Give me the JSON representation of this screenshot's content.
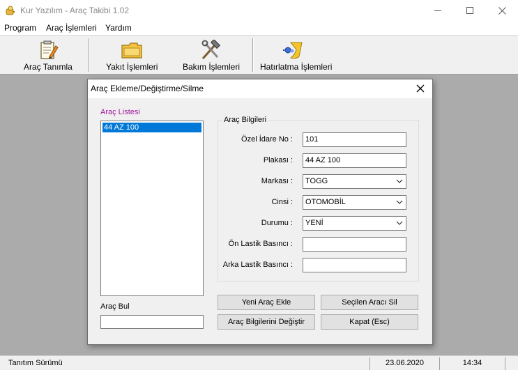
{
  "window": {
    "title": "Kur Yazılım - Araç Takibi 1.02",
    "icons": [
      "app-icon",
      "minimize-icon",
      "maximize-icon",
      "close-icon"
    ]
  },
  "menu": {
    "items": [
      "Program",
      "Araç İşlemleri",
      "Yardım"
    ]
  },
  "toolbar": {
    "buttons": [
      {
        "label": "Araç Tanımla",
        "icon": "clipboard-pencil-icon"
      },
      {
        "label": "Yakıt İşlemleri",
        "icon": "folder-icon"
      },
      {
        "label": "Bakım İşlemleri",
        "icon": "tools-icon"
      },
      {
        "label": "Hatırlatma İşlemleri",
        "icon": "reminder-icon"
      }
    ]
  },
  "dialog": {
    "title": "Araç Ekleme/Değiştirme/Silme",
    "list_label": "Araç Listesi",
    "list_items": [
      "44 AZ 100"
    ],
    "selected_index": 0,
    "search_label": "Araç Bul",
    "search_value": "",
    "group_title": "Araç Bilgileri",
    "fields": [
      {
        "label": "Özel İdare No :",
        "value": "101",
        "type": "text"
      },
      {
        "label": "Plakası :",
        "value": "44 AZ 100",
        "type": "text"
      },
      {
        "label": "Markası :",
        "value": "TOGG",
        "type": "select"
      },
      {
        "label": "Cinsi :",
        "value": "OTOMOBİL",
        "type": "select"
      },
      {
        "label": "Durumu :",
        "value": "YENİ",
        "type": "select"
      },
      {
        "label": "Ön Lastik Basıncı :",
        "value": "",
        "type": "text"
      },
      {
        "label": "Arka Lastik Basıncı :",
        "value": "",
        "type": "text"
      }
    ],
    "buttons": {
      "new": "Yeni Araç Ekle",
      "delete": "Seçilen Aracı Sil",
      "update": "Araç Bilgilerini Değiştir",
      "close": "Kapat (Esc)"
    }
  },
  "status": {
    "mode": "Tanıtım Sürümü",
    "date": "23.06.2020",
    "time": "14:34"
  },
  "colors": {
    "mdi_background": "#ababab",
    "selection": "#0078d7",
    "list_label": "#a0159b"
  }
}
